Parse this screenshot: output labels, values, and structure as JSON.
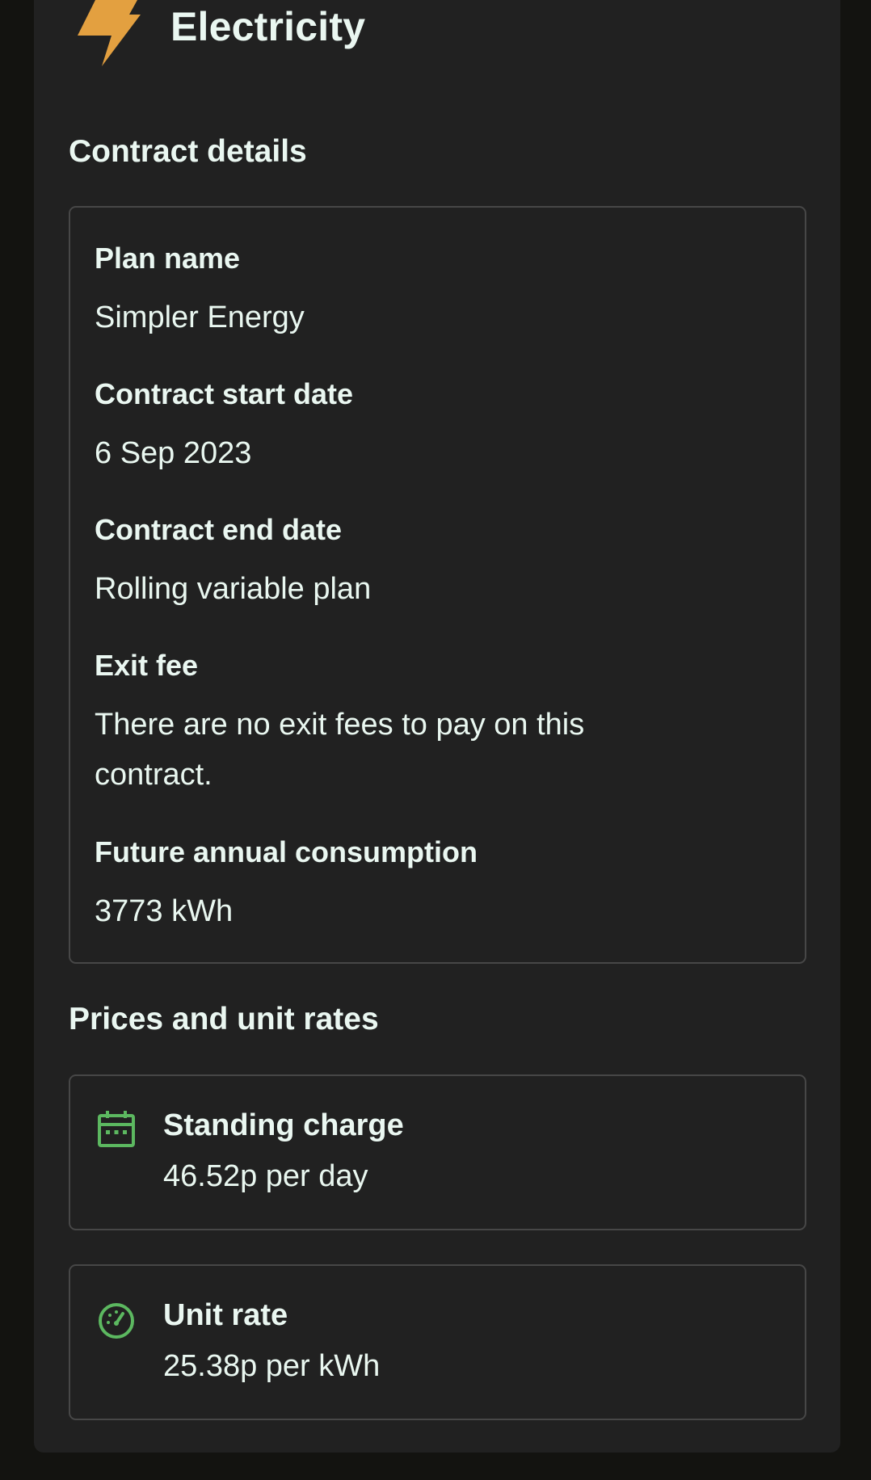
{
  "header": {
    "title": "Electricity",
    "icon": "lightning-bolt-icon",
    "icon_color": "#E3A040"
  },
  "contract": {
    "section_title": "Contract details",
    "fields": [
      {
        "label": "Plan name",
        "value": "Simpler Energy"
      },
      {
        "label": "Contract start date",
        "value": "6 Sep 2023"
      },
      {
        "label": "Contract end date",
        "value": "Rolling variable plan"
      },
      {
        "label": "Exit fee",
        "value": "There are no exit fees to pay on this contract."
      },
      {
        "label": "Future annual consumption",
        "value": "3773 kWh"
      }
    ]
  },
  "prices": {
    "section_title": "Prices and unit rates",
    "accent_color": "#5CB860",
    "items": [
      {
        "label": "Standing charge",
        "value": "46.52p per day",
        "icon": "calendar-icon"
      },
      {
        "label": "Unit rate",
        "value": "25.38p per kWh",
        "icon": "gauge-icon"
      }
    ]
  }
}
